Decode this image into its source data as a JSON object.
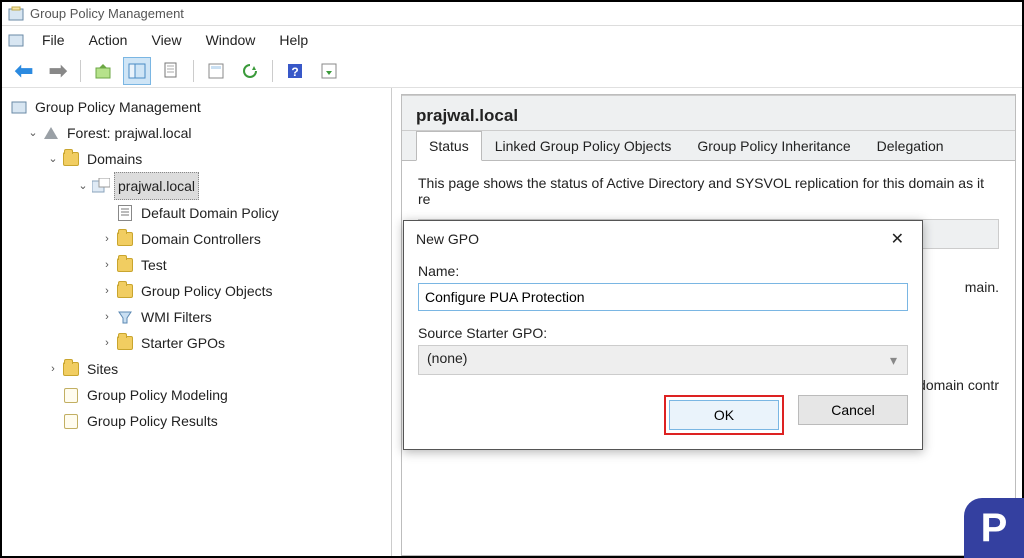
{
  "titlebar": {
    "title": "Group Policy Management"
  },
  "menubar": {
    "items": [
      "File",
      "Action",
      "View",
      "Window",
      "Help"
    ]
  },
  "tree": {
    "root": "Group Policy Management",
    "forest": "Forest: prajwal.local",
    "domains": "Domains",
    "domain": "prajwal.local",
    "nodes": {
      "defaultPolicy": "Default Domain Policy",
      "domainControllers": "Domain Controllers",
      "test": "Test",
      "gpo": "Group Policy Objects",
      "wmi": "WMI Filters",
      "starter": "Starter GPOs",
      "sites": "Sites",
      "modeling": "Group Policy Modeling",
      "results": "Group Policy Results"
    }
  },
  "right": {
    "heading": "prajwal.local",
    "tabs": [
      "Status",
      "Linked Group Policy Objects",
      "Group Policy Inheritance",
      "Delegation"
    ],
    "statusText1": "This page shows the status of Active Directory and SYSVOL replication for this domain as it re",
    "statusText2": "main.",
    "statusText3": "the domain contr"
  },
  "dialog": {
    "title": "New GPO",
    "nameLabel": "Name:",
    "nameValue": "Configure PUA Protection",
    "sourceLabel": "Source Starter GPO:",
    "sourceValue": "(none)",
    "ok": "OK",
    "cancel": "Cancel"
  }
}
